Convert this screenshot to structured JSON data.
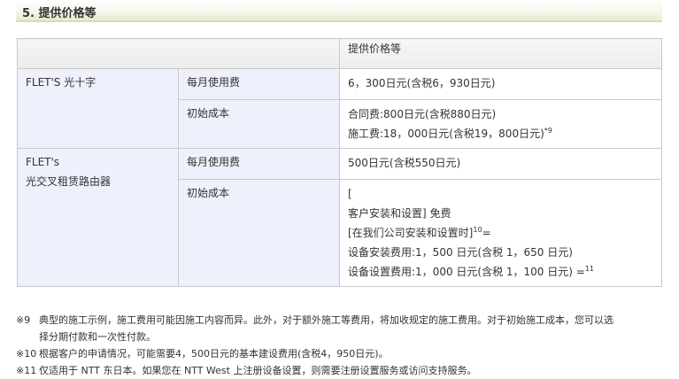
{
  "section": {
    "title": "5. 提供价格等"
  },
  "table": {
    "header": {
      "price_label": "提供价格等"
    },
    "services": [
      {
        "name_lines": [
          "FLET'S 光十字"
        ],
        "monthly": {
          "label": "每月使用费",
          "value": "6，300日元(含税6，930日元)"
        },
        "initial": {
          "label": "初始成本",
          "lines": [
            {
              "text": "合同费:800日元(含税880日元)",
              "sup": ""
            },
            {
              "text": "施工费:18，000日元(含税19，800日元)",
              "sup": "*9"
            }
          ]
        }
      },
      {
        "name_lines": [
          "FLET's",
          "光交叉租赁路由器"
        ],
        "monthly": {
          "label": "每月使用费",
          "value": "500日元(含税550日元)"
        },
        "initial": {
          "label": "初始成本",
          "lines": [
            {
              "text": "[",
              "sup": ""
            },
            {
              "text": "客户安装和设置] 免费",
              "sup": ""
            },
            {
              "text": "[在我们公司安装和设置时]",
              "sup": "10",
              "after": "="
            },
            {
              "text": "设备安装费用:1，500 日元(含税 1，650 日元)",
              "sup": ""
            },
            {
              "text": "设备设置费用:1，000 日元(含税 1，100 日元) =",
              "sup": "11"
            }
          ]
        }
      }
    ]
  },
  "notes": [
    {
      "mark": "※9",
      "lines": [
        "典型的施工示例，施工费用可能因施工内容而异。此外，对于额外施工等费用，将加收规定的施工费用。对于初始施工成本，您可以选",
        "择分期付款和一次性付款。"
      ]
    },
    {
      "mark": "※10",
      "lines": [
        "根据客户的申请情况，可能需要4，500日元的基本建设费用(含税4，950日元)。"
      ]
    },
    {
      "mark": "※11",
      "lines": [
        "仅适用于 NTT 东日本。如果您在 NTT West 上注册设备设置，则需要注册设置服务或访问支持服务。"
      ]
    }
  ]
}
